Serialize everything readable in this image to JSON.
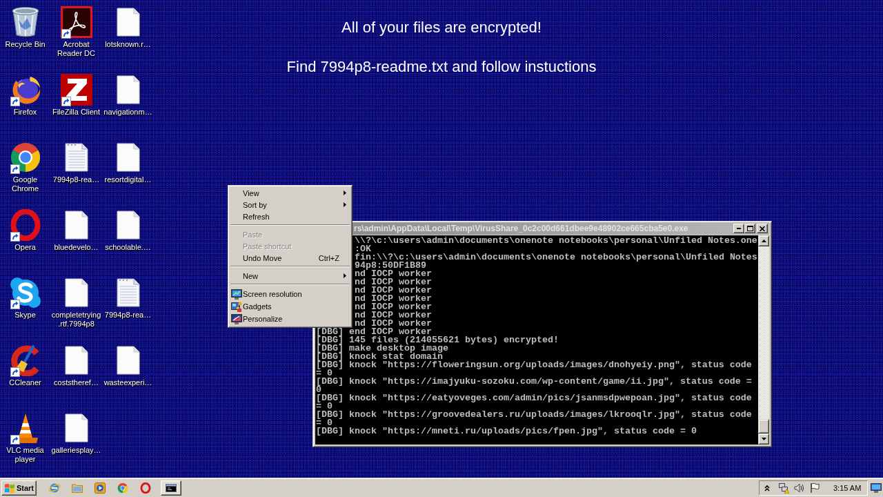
{
  "wallpaper": {
    "heading": "All of your files are encrypted!",
    "instruction": "Find 7994p8-readme.txt and follow instuctions"
  },
  "desktop_icons": [
    {
      "label": "Recycle Bin",
      "kind": "system",
      "shortcut": false
    },
    {
      "label": "Acrobat Reader DC",
      "kind": "app",
      "shortcut": true
    },
    {
      "label": "lotsknown.r…",
      "kind": "file",
      "shortcut": false
    },
    {
      "label": "Firefox",
      "kind": "app",
      "shortcut": true
    },
    {
      "label": "FileZilla Client",
      "kind": "app",
      "shortcut": true
    },
    {
      "label": "navigationm…",
      "kind": "file",
      "shortcut": false
    },
    {
      "label": "Google Chrome",
      "kind": "app",
      "shortcut": true
    },
    {
      "label": "7994p8-rea…",
      "kind": "text_file",
      "shortcut": false
    },
    {
      "label": "resortdigital…",
      "kind": "file",
      "shortcut": false
    },
    {
      "label": "Opera",
      "kind": "app",
      "shortcut": true
    },
    {
      "label": "bluedevelo…",
      "kind": "file",
      "shortcut": false
    },
    {
      "label": "schoolable.…",
      "kind": "file",
      "shortcut": false
    },
    {
      "label": "Skype",
      "kind": "app",
      "shortcut": true
    },
    {
      "label": "completetrying.rtf.7994p8",
      "kind": "file",
      "shortcut": false
    },
    {
      "label": "7994p8-rea…",
      "kind": "text_file",
      "shortcut": false
    },
    {
      "label": "CCleaner",
      "kind": "app",
      "shortcut": true
    },
    {
      "label": "coststheref…",
      "kind": "file",
      "shortcut": false
    },
    {
      "label": "wasteexperi…",
      "kind": "file",
      "shortcut": false
    },
    {
      "label": "VLC media player",
      "kind": "app",
      "shortcut": true
    },
    {
      "label": "galleriesplay…",
      "kind": "file",
      "shortcut": false
    }
  ],
  "console_window": {
    "title": "rs\\admin\\AppData\\Local\\Temp\\VirusShare_0c2c00d661dbee9e48902ce665cba5e0.exe",
    "lines": [
      {
        "text": "\\\\?\\c:\\users\\admin\\documents\\onenote notebooks\\personal\\Unfiled Notes.one",
        "kind": "clipped"
      },
      {
        "text": ":OK",
        "kind": "clipped"
      },
      {
        "text": "fin:\\\\?\\c:\\users\\admin\\documents\\onenote notebooks\\personal\\Unfiled Notes",
        "kind": "clipped"
      },
      {
        "text": "94p8:50DF1B89",
        "kind": "clipped"
      },
      {
        "text": "nd IOCP worker",
        "kind": "clipped"
      },
      {
        "text": "nd IOCP worker",
        "kind": "clipped"
      },
      {
        "text": "nd IOCP worker",
        "kind": "clipped"
      },
      {
        "text": "nd IOCP worker",
        "kind": "clipped"
      },
      {
        "text": "nd IOCP worker",
        "kind": "clipped"
      },
      {
        "text": "nd IOCP worker",
        "kind": "clipped"
      },
      {
        "text": "nd IOCP worker",
        "kind": "clipped"
      },
      {
        "text": "[DBG] end IOCP worker",
        "kind": "full"
      },
      {
        "text": "[DBG] 145 files (214055621 bytes) encrypted!",
        "kind": "full"
      },
      {
        "text": "[DBG] make desktop image",
        "kind": "full"
      },
      {
        "text": "[DBG] knock stat domain",
        "kind": "full"
      },
      {
        "text": "[DBG] knock \"https://floweringsun.org/uploads/images/dnohyeiy.png\", status code",
        "kind": "full"
      },
      {
        "text": "= 0",
        "kind": "full"
      },
      {
        "text": "[DBG] knock \"https://imajyuku-sozoku.com/wp-content/game/ii.jpg\", status code =",
        "kind": "full"
      },
      {
        "text": "0",
        "kind": "full"
      },
      {
        "text": "[DBG] knock \"https://eatyoveges.com/admin/pics/jsanmsdpwepoan.jpg\", status code",
        "kind": "full"
      },
      {
        "text": "= 0",
        "kind": "full"
      },
      {
        "text": "[DBG] knock \"https://groovedealers.ru/uploads/images/lkrooqlr.jpg\", status code",
        "kind": "full"
      },
      {
        "text": "= 0",
        "kind": "full"
      },
      {
        "text": "[DBG] knock \"https://mneti.ru/uploads/pics/fpen.jpg\", status code = 0",
        "kind": "full"
      }
    ]
  },
  "context_menu": {
    "items": [
      {
        "kind": "item",
        "label": "View",
        "disabled": false,
        "submenu": true
      },
      {
        "kind": "item",
        "label": "Sort by",
        "disabled": false,
        "submenu": true
      },
      {
        "kind": "item",
        "label": "Refresh",
        "disabled": false,
        "submenu": false
      },
      {
        "kind": "separator"
      },
      {
        "kind": "item",
        "label": "Paste",
        "disabled": true,
        "submenu": false
      },
      {
        "kind": "item",
        "label": "Paste shortcut",
        "disabled": true,
        "submenu": false
      },
      {
        "kind": "item",
        "label": "Undo Move",
        "shortcut": "Ctrl+Z",
        "disabled": false,
        "submenu": false
      },
      {
        "kind": "separator"
      },
      {
        "kind": "item",
        "label": "New",
        "disabled": false,
        "submenu": true
      },
      {
        "kind": "separator"
      },
      {
        "kind": "icon_item",
        "label": "Screen resolution",
        "disabled": false,
        "submenu": false
      },
      {
        "kind": "icon_item",
        "label": "Gadgets",
        "disabled": false,
        "submenu": false
      },
      {
        "kind": "icon_item",
        "label": "Personalize",
        "disabled": false,
        "submenu": false
      }
    ]
  },
  "taskbar": {
    "start_label": "Start",
    "clock": "3:15 AM"
  }
}
